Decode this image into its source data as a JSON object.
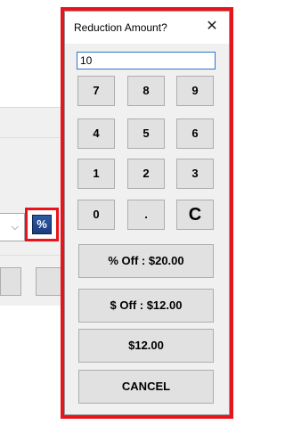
{
  "background": {
    "percent_button_label": "%",
    "combo_chevron": "⌵"
  },
  "dialog": {
    "title": "Reduction Amount?",
    "close_label": "✕",
    "amount_value": "10",
    "keypad": {
      "row1": [
        "7",
        "8",
        "9"
      ],
      "row2": [
        "4",
        "5",
        "6"
      ],
      "row3": [
        "1",
        "2",
        "3"
      ],
      "row4": [
        "0",
        ".",
        "C"
      ]
    },
    "percent_off_label": "% Off : $20.00",
    "dollar_off_label": "$ Off : $12.00",
    "amount_label": "$12.00",
    "cancel_label": "CANCEL"
  },
  "colors": {
    "highlight": "#e8141c",
    "dialog_bg": "#f0f0f0",
    "button_bg": "#e1e1e1",
    "input_border": "#2b76c9",
    "percent_button_bg": "#1b3d7c"
  }
}
